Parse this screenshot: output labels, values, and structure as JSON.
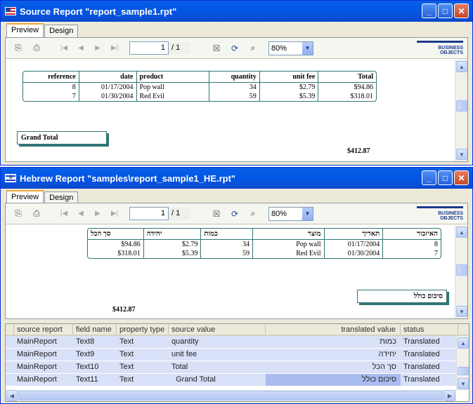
{
  "win1": {
    "title": "Source Report \"report_sample1.rpt\"",
    "tabs": [
      "Preview",
      "Design"
    ],
    "page_current": "1",
    "page_total": "/ 1",
    "zoom": "80%",
    "logo": "BUSINESS OBJECTS",
    "table": {
      "headers": [
        "reference",
        "date",
        "product",
        "quantity",
        "unit fee",
        "Total"
      ],
      "rows": [
        [
          "8",
          "01/17/2004",
          "Pop wall",
          "34",
          "$2.79",
          "$94.86"
        ],
        [
          "7",
          "01/30/2004",
          "Red Evil",
          "59",
          "$5.39",
          "$318.01"
        ]
      ]
    },
    "grand_total_label": "Grand Total",
    "grand_total_value": "$412.87"
  },
  "win2": {
    "title": "Hebrew Report \"samples\\report_sample1_HE.rpt\"",
    "tabs": [
      "Preview",
      "Design"
    ],
    "page_current": "1",
    "page_total": "/ 1",
    "zoom": "80%",
    "logo": "BUSINESS OBJECTS",
    "table": {
      "headers": [
        "סך הכל",
        "יחידה",
        "כמות",
        "מוצר",
        "תאריך",
        "האיזכור"
      ],
      "rows": [
        [
          "$94.86",
          "$2.79",
          "34",
          "Pop wall",
          "01/17/2004",
          "8"
        ],
        [
          "$318.01",
          "$5.39",
          "59",
          "Red Evil",
          "01/30/2004",
          "7"
        ]
      ]
    },
    "grand_total_label": "סיכום כולל",
    "grand_total_value": "$412.87"
  },
  "grid": {
    "headers": [
      "source report",
      "field name",
      "property type",
      "source value",
      "translated value",
      "status"
    ],
    "rows": [
      [
        "MainReport",
        "Text8",
        "Text",
        "quantity",
        "כמות",
        "Translated"
      ],
      [
        "MainReport",
        "Text9",
        "Text",
        "unit fee",
        "יחידה",
        "Translated"
      ],
      [
        "MainReport",
        "Text10",
        "Text",
        "Total",
        "סך הכל",
        "Translated"
      ],
      [
        "MainReport",
        "Text11",
        "Text",
        "  Grand Total",
        "סיכום כולל",
        "Translated"
      ]
    ]
  }
}
